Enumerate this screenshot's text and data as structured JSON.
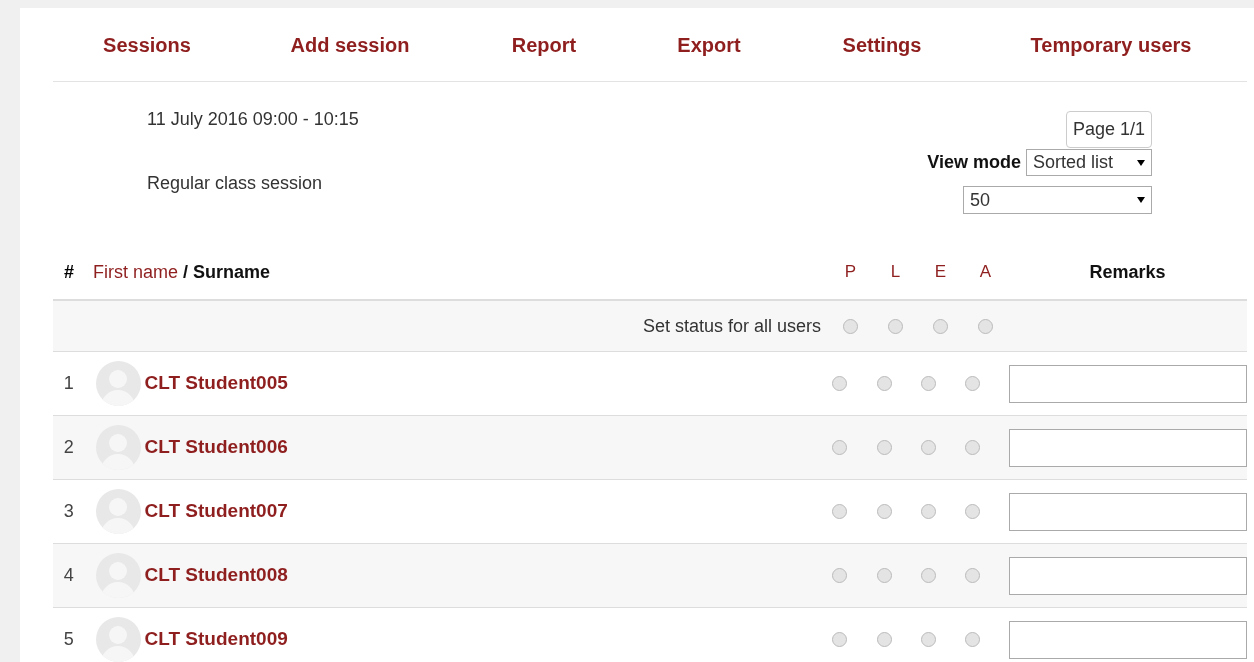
{
  "tabs": [
    {
      "label": "Sessions"
    },
    {
      "label": "Add session"
    },
    {
      "label": "Report"
    },
    {
      "label": "Export"
    },
    {
      "label": "Settings"
    },
    {
      "label": "Temporary users"
    }
  ],
  "session": {
    "date": "11 July 2016 09:00 - 10:15",
    "description": "Regular class session"
  },
  "pager": {
    "label": "Page 1/1"
  },
  "view_mode": {
    "label": "View mode",
    "value": "Sorted list"
  },
  "per_page": {
    "value": "50"
  },
  "table": {
    "columns": {
      "number": "#",
      "first_name": "First name",
      "surname": "/ Surname",
      "statuses": [
        "P",
        "L",
        "E",
        "A"
      ],
      "remarks": "Remarks"
    },
    "set_all": {
      "label": "Set status for all users",
      "options": [
        {
          "selected": false
        },
        {
          "selected": false
        },
        {
          "selected": false
        },
        {
          "selected": false
        }
      ]
    },
    "rows": [
      {
        "number": "1",
        "name": "CLT Student005",
        "options": [
          {
            "selected": false
          },
          {
            "selected": false
          },
          {
            "selected": false
          },
          {
            "selected": false
          }
        ]
      },
      {
        "number": "2",
        "name": "CLT Student006",
        "options": [
          {
            "selected": false
          },
          {
            "selected": false
          },
          {
            "selected": false
          },
          {
            "selected": false
          }
        ]
      },
      {
        "number": "3",
        "name": "CLT Student007",
        "options": [
          {
            "selected": false
          },
          {
            "selected": false
          },
          {
            "selected": false
          },
          {
            "selected": false
          }
        ]
      },
      {
        "number": "4",
        "name": "CLT Student008",
        "options": [
          {
            "selected": false
          },
          {
            "selected": false
          },
          {
            "selected": false
          },
          {
            "selected": false
          }
        ]
      },
      {
        "number": "5",
        "name": "CLT Student009",
        "options": [
          {
            "selected": false
          },
          {
            "selected": false
          },
          {
            "selected": false
          },
          {
            "selected": false
          }
        ]
      }
    ]
  }
}
